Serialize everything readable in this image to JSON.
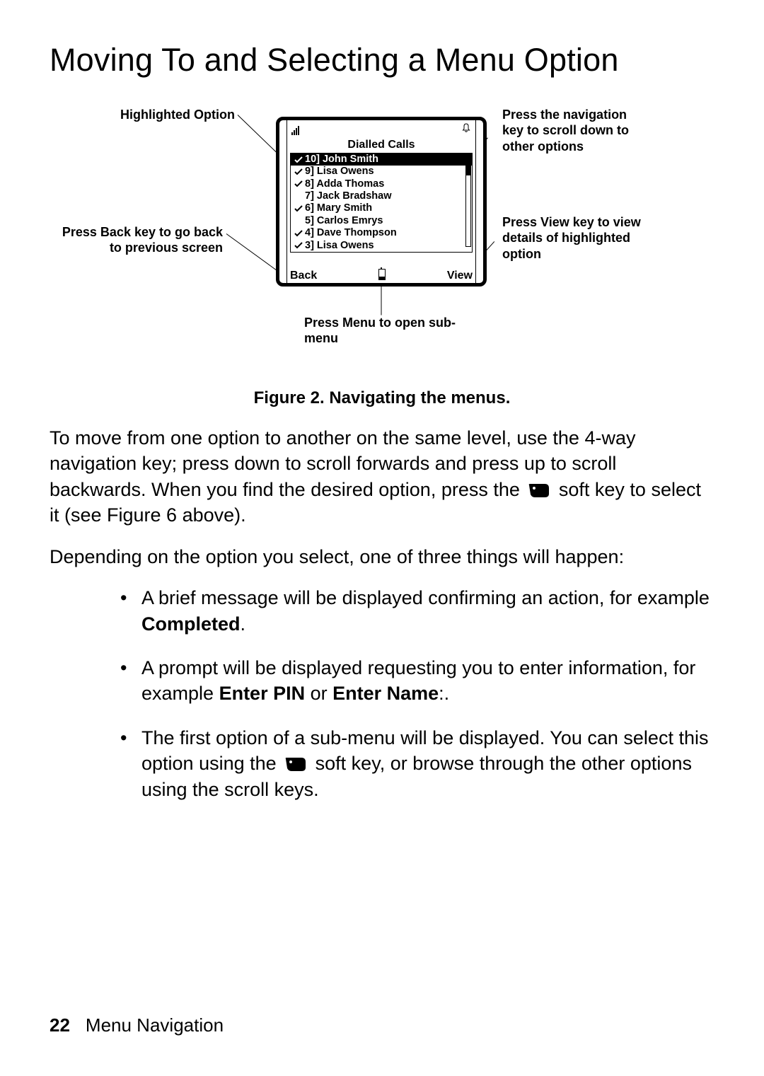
{
  "heading": "Moving To and Selecting a Menu Option",
  "figure": {
    "callouts": {
      "highlighted": "Highlighted Option",
      "back_key": "Press Back key to go back to previous screen",
      "nav_key": "Press the navigation key to scroll down to other options",
      "view_key": "Press View key to view details of highlighted option",
      "menu_key": "Press Menu to open sub-menu"
    },
    "phone": {
      "title": "Dialled Calls",
      "rows": [
        {
          "n": "10]",
          "name": "John Smith",
          "checked": true,
          "selected": true
        },
        {
          "n": "9]",
          "name": "Lisa Owens",
          "checked": true,
          "selected": false
        },
        {
          "n": "8]",
          "name": "Adda Thomas",
          "checked": true,
          "selected": false
        },
        {
          "n": "7]",
          "name": "Jack Bradshaw",
          "checked": false,
          "selected": false
        },
        {
          "n": "6]",
          "name": "Mary Smith",
          "checked": true,
          "selected": false
        },
        {
          "n": "5]",
          "name": "Carlos Emrys",
          "checked": false,
          "selected": false
        },
        {
          "n": "4]",
          "name": "Dave Thompson",
          "checked": true,
          "selected": false
        },
        {
          "n": "3]",
          "name": "Lisa Owens",
          "checked": true,
          "selected": false
        }
      ],
      "soft_left": "Back",
      "soft_right": "View"
    },
    "caption": "Figure 2. Navigating the menus."
  },
  "para1_a": "To move from one option to another on the same level, use the 4-way navigation key; press down to scroll forwards and press up to scroll backwards. When you find the desired option, press the ",
  "para1_b": " soft key to select it (see Figure 6 above).",
  "para2": "Depending on the option you select, one of three things will happen:",
  "bullets": {
    "b1_a": "A brief message will be displayed confirming an action, for example ",
    "b1_bold": "Completed",
    "b1_c": ".",
    "b2_a": "A prompt will be displayed requesting you to enter information, for example ",
    "b2_bold1": "Enter PIN",
    "b2_mid": " or ",
    "b2_bold2": "Enter Name",
    "b2_c": ":.",
    "b3_a": "The first option of a sub-menu will be displayed. You can select this option using the ",
    "b3_b": " soft key, or browse through the other options using the scroll keys."
  },
  "footer": {
    "page": "22",
    "section": "Menu Navigation"
  }
}
